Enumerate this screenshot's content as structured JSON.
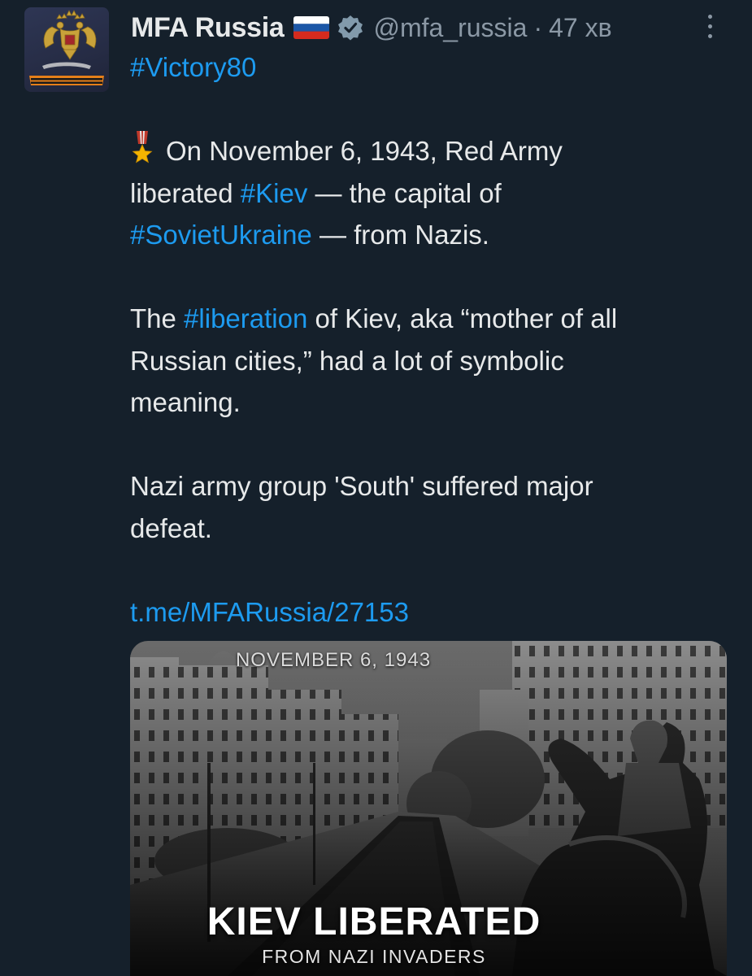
{
  "author": {
    "name": "MFA Russia",
    "flag_icon": "russia-flag-emoji",
    "verified_icon": "verified-badge-icon",
    "handle": "@mfa_russia",
    "separator": "·",
    "time": "47 хв"
  },
  "tweet": {
    "line1": "#Victory80",
    "medal_icon": "military-medal-emoji",
    "p1_l1": "On November 6, 1943, Red Army",
    "p1_l2_a": "liberated ",
    "p1_l2_tag": "#Kiev",
    "p1_l2_b": " — the capital of",
    "p1_l3_tag": "#SovietUkraine",
    "p1_l3_b": " — from Nazis.",
    "p2_l1_a": "The ",
    "p2_l1_tag": "#liberation",
    "p2_l1_b": " of Kiev, aka “mother of all",
    "p2_l2": "Russian cities,” had a lot of symbolic",
    "p2_l3": "meaning.",
    "p3_l1": "Nazi army group 'South' suffered major",
    "p3_l2": "defeat.",
    "link": "t.me/MFARussia/27153"
  },
  "media": {
    "date": "NOVEMBER 6, 1943",
    "title": "KIEV LIBERATED",
    "subtitle": "FROM NAZI INVADERS"
  },
  "colors": {
    "background": "#15202b",
    "text": "#e7e9ea",
    "secondary": "#8b98a5",
    "accent": "#1d9bf0"
  }
}
